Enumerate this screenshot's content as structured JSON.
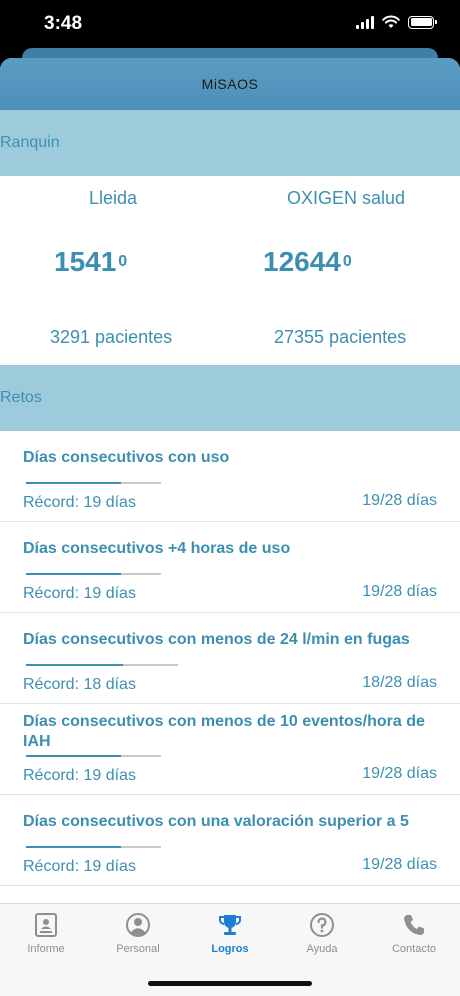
{
  "status_bar": {
    "time": "3:48"
  },
  "app": {
    "title": "MiSAOS"
  },
  "ranking": {
    "header": "Ranquin",
    "left": {
      "name": "Lleida",
      "score": "1541",
      "score_suffix": "0",
      "patients": "3291 pacientes"
    },
    "right": {
      "name": "OXIGEN salud",
      "score": "12644",
      "score_suffix": "0",
      "patients": "27355 pacientes"
    }
  },
  "retos": {
    "header": "Retos",
    "items": [
      {
        "title": "Días consecutivos con uso",
        "record": "Récord: 19 días",
        "count": "19/28 días",
        "progress": 0.7
      },
      {
        "title": "Días consecutivos +4 horas de uso",
        "record": "Récord: 19 días",
        "count": "19/28 días",
        "progress": 0.7
      },
      {
        "title": "Días consecutivos con menos de 24 l/min en fugas",
        "record": "Récord: 18 días",
        "count": "18/28 días",
        "progress": 0.64
      },
      {
        "title": "Días consecutivos con menos de 10 eventos/hora de IAH",
        "record": "Récord: 19 días",
        "count": "19/28 días",
        "progress": 0.7
      },
      {
        "title": "Días consecutivos con una valoración superior a 5",
        "record": "Récord: 19 días",
        "count": "19/28 días",
        "progress": 0.7
      }
    ]
  },
  "tabs": [
    {
      "label": "Informe",
      "icon": "report-icon"
    },
    {
      "label": "Personal",
      "icon": "person-icon"
    },
    {
      "label": "Logros",
      "icon": "trophy-icon",
      "active": true
    },
    {
      "label": "Ayuda",
      "icon": "help-icon"
    },
    {
      "label": "Contacto",
      "icon": "phone-icon"
    }
  ],
  "colors": {
    "accent": "#3d8fb2",
    "header_band": "#9ecbdc",
    "nav_bar": "#4d8fb8",
    "active_tab": "#1b7fd8"
  }
}
